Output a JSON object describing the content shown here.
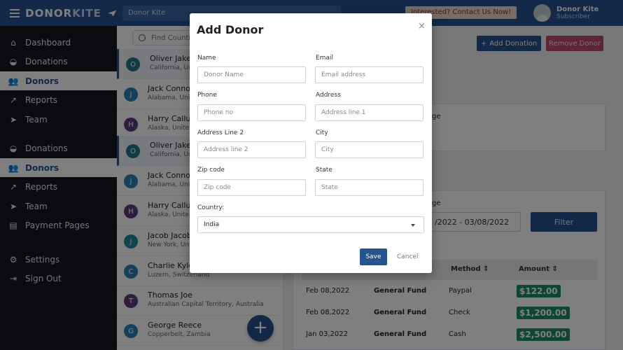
{
  "header": {
    "brand_a": "DONOR",
    "brand_b": "KITE",
    "search_text": "Donor Kite",
    "interest_link": "Interested? Contact Us Now!",
    "user_name": "Donor Kite",
    "user_role": "Subscriber"
  },
  "sidebar": {
    "items": [
      {
        "label": "Dashboard",
        "icon": "home-icon"
      },
      {
        "label": "Donations",
        "icon": "donation-icon"
      },
      {
        "label": "Donors",
        "icon": "users-icon"
      },
      {
        "label": "Reports",
        "icon": "chart-icon"
      },
      {
        "label": "Team",
        "icon": "send-icon"
      },
      {
        "label": "Donations",
        "icon": "donation-icon"
      },
      {
        "label": "Donors",
        "icon": "users-icon"
      },
      {
        "label": "Reports",
        "icon": "chart-icon"
      },
      {
        "label": "Team",
        "icon": "send-icon"
      },
      {
        "label": "Payment Pages",
        "icon": "page-icon"
      },
      {
        "label": "Settings",
        "icon": "gear-icon"
      },
      {
        "label": "Sign Out",
        "icon": "signout-icon"
      }
    ]
  },
  "donors": {
    "search_placeholder": "Find Countri",
    "rows": [
      {
        "initial": "O",
        "name": "Oliver Jakes",
        "location": "California, Uni",
        "color": "#1f7a86"
      },
      {
        "initial": "J",
        "name": "Jack Connor",
        "location": "Alabama, Unite",
        "color": "#2a7fb5"
      },
      {
        "initial": "H",
        "name": "Harry Callum",
        "location": "Alaska, Unite",
        "color": "#5b3f7a"
      },
      {
        "initial": "O",
        "name": "Oliver Jakes",
        "location": "California, Uni",
        "color": "#1f7a86"
      },
      {
        "initial": "J",
        "name": "Jack Connor",
        "location": "Alabama, Unite",
        "color": "#2a7fb5"
      },
      {
        "initial": "H",
        "name": "Harry Callum",
        "location": "Alaska, Unite",
        "color": "#5b3f7a"
      },
      {
        "initial": "J",
        "name": "Jacob Jacob",
        "location": "New York, Uni",
        "color": "#1f8aa0"
      },
      {
        "initial": "C",
        "name": "Charlie Kyle",
        "location": "Luzern, Switzerland",
        "color": "#2a7fb5"
      },
      {
        "initial": "T",
        "name": "Thomas Joe",
        "location": "Australian Capital Territory, Australia",
        "color": "#5b3f7a"
      },
      {
        "initial": "G",
        "name": "George Reece",
        "location": "Copperbelt, Zambia",
        "color": "#2a7fb5"
      }
    ],
    "fab": "+"
  },
  "right": {
    "add_donation": "Add Donation",
    "remove_donor": "Remove Donor",
    "range_label_1": "ge",
    "range_label_2": "ge",
    "range_value": "/2022 - 03/08/2022",
    "filter": "Filter",
    "columns": [
      "Method",
      "Amount"
    ],
    "rows": [
      {
        "date": "Feb 08,2022",
        "fund": "General Fund",
        "method": "Paypal",
        "amount": "$122.00"
      },
      {
        "date": "Feb 08,2022",
        "fund": "General Fund",
        "method": "Check",
        "amount": "$1,200.00"
      },
      {
        "date": "Jan 03,2022",
        "fund": "General Fund",
        "method": "Cash",
        "amount": "$2,500.00"
      }
    ]
  },
  "modal": {
    "title": "Add Donor",
    "close": "×",
    "fields": {
      "name": {
        "label": "Name",
        "placeholder": "Donor Name"
      },
      "email": {
        "label": "Email",
        "placeholder": "Email address"
      },
      "phone": {
        "label": "Phone",
        "placeholder": "Phone no"
      },
      "address": {
        "label": "Address",
        "placeholder": "Address line 1"
      },
      "address2": {
        "label": "Address Line 2",
        "placeholder": "Address line 2"
      },
      "city": {
        "label": "City",
        "placeholder": "City"
      },
      "zip": {
        "label": "Zip code",
        "placeholder": "Zip code"
      },
      "state": {
        "label": "State",
        "placeholder": "State"
      },
      "country": {
        "label": "Country:",
        "value": "India"
      }
    },
    "save": "Save",
    "cancel": "Cancel"
  }
}
